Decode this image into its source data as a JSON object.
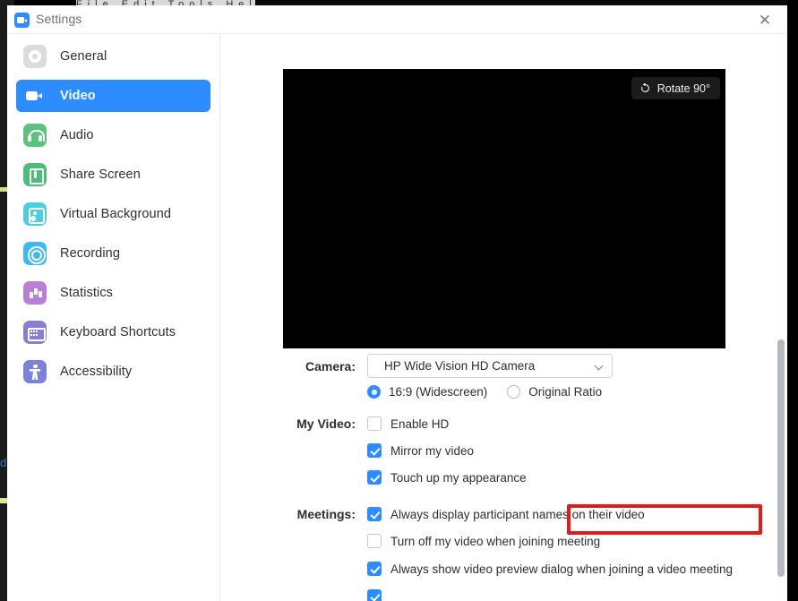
{
  "background": {
    "menubar_text": "File  Edit  Tools  Help",
    "side_text": "di"
  },
  "window": {
    "title": "Settings",
    "app_icon": "zoom-video-icon",
    "close_icon": "✕"
  },
  "sidebar": {
    "items": [
      {
        "label": "General",
        "icon": "gear-icon",
        "active": false
      },
      {
        "label": "Video",
        "icon": "video-camera-icon",
        "active": true
      },
      {
        "label": "Audio",
        "icon": "headphones-icon",
        "active": false
      },
      {
        "label": "Share Screen",
        "icon": "share-screen-icon",
        "active": false
      },
      {
        "label": "Virtual Background",
        "icon": "virtual-background-icon",
        "active": false
      },
      {
        "label": "Recording",
        "icon": "record-icon",
        "active": false
      },
      {
        "label": "Statistics",
        "icon": "bar-chart-icon",
        "active": false
      },
      {
        "label": "Keyboard Shortcuts",
        "icon": "keyboard-icon",
        "active": false
      },
      {
        "label": "Accessibility",
        "icon": "accessibility-icon",
        "active": false
      }
    ]
  },
  "preview": {
    "rotate_label": "Rotate 90°",
    "rotate_icon": "rotate-ccw-icon",
    "background_color": "#000000"
  },
  "camera": {
    "label": "Camera:",
    "selected": "HP Wide Vision HD Camera",
    "options": [
      "HP Wide Vision HD Camera"
    ],
    "aspect_ratio": [
      {
        "label": "16:9 (Widescreen)",
        "selected": true
      },
      {
        "label": "Original Ratio",
        "selected": false
      }
    ]
  },
  "my_video": {
    "label": "My Video:",
    "options": [
      {
        "label": "Enable HD",
        "checked": false
      },
      {
        "label": "Mirror my video",
        "checked": true
      },
      {
        "label": "Touch up my appearance",
        "checked": true,
        "highlighted": true
      }
    ]
  },
  "meetings": {
    "label": "Meetings:",
    "options": [
      {
        "label": "Always display participant names on their video",
        "checked": true
      },
      {
        "label": "Turn off my video when joining meeting",
        "checked": false
      },
      {
        "label": "Always show video preview dialog when joining a video meeting",
        "checked": true
      }
    ]
  },
  "colors": {
    "accent": "#2d8cff",
    "annotation": "#e8171b",
    "scrollbar": "#b6b9bf"
  }
}
